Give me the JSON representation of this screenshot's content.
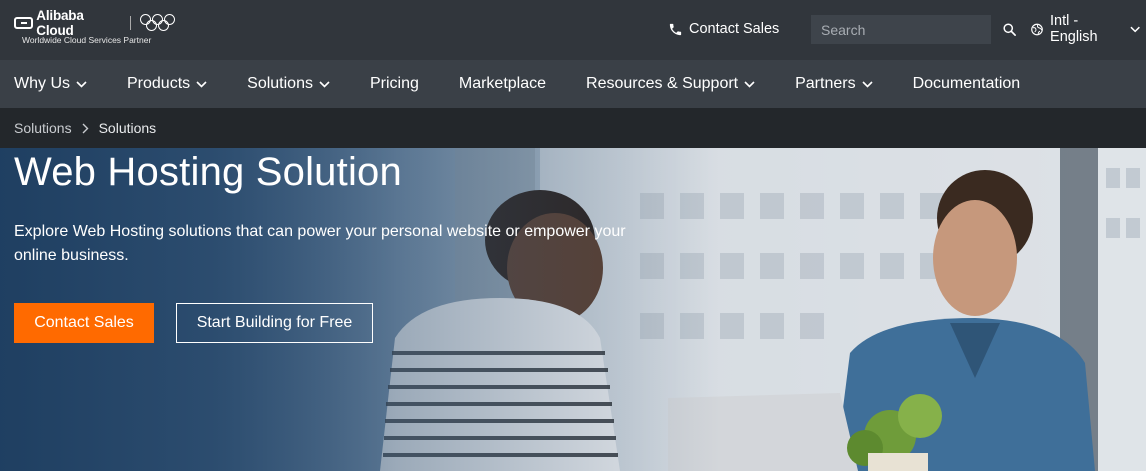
{
  "header": {
    "logo_text": "Alibaba Cloud",
    "logo_subtext": "Worldwide Cloud Services Partner",
    "contact_label": "Contact Sales",
    "search": {
      "placeholder": "Search",
      "value": ""
    },
    "language_label": "Intl - English"
  },
  "nav": {
    "items": [
      {
        "label": "Why Us",
        "dropdown": true
      },
      {
        "label": "Products",
        "dropdown": true
      },
      {
        "label": "Solutions",
        "dropdown": true
      },
      {
        "label": "Pricing",
        "dropdown": false
      },
      {
        "label": "Marketplace",
        "dropdown": false
      },
      {
        "label": "Resources & Support",
        "dropdown": true
      },
      {
        "label": "Partners",
        "dropdown": true
      },
      {
        "label": "Documentation",
        "dropdown": false
      }
    ]
  },
  "breadcrumb": {
    "items": [
      "Solutions",
      "Solutions"
    ]
  },
  "hero": {
    "title": "Web Hosting Solution",
    "description": "Explore Web Hosting solutions that can power your personal website or empower your online business.",
    "primary_button": "Contact Sales",
    "secondary_button": "Start Building for Free"
  },
  "colors": {
    "accent": "#ff6a00",
    "topbar": "#31363c",
    "nav": "#3a4047",
    "breadcrumb_bg": "#23272b"
  },
  "icons": {
    "phone": "phone-icon",
    "search": "search-icon",
    "globe": "globe-icon",
    "chevron": "chevron-down-icon"
  }
}
